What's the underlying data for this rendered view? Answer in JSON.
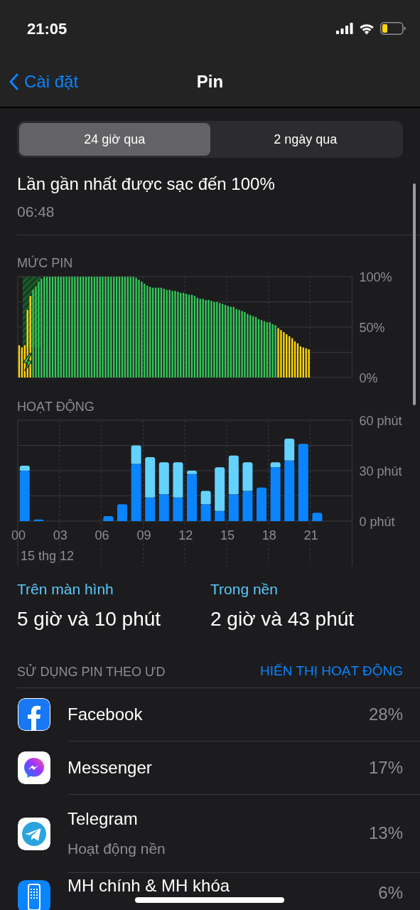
{
  "status_bar": {
    "time": "21:05"
  },
  "nav": {
    "back": "Cài đặt",
    "title": "Pin"
  },
  "segments": [
    {
      "label": "24 giờ qua",
      "selected": true
    },
    {
      "label": "2 ngày qua",
      "selected": false
    }
  ],
  "last_charged": {
    "title": "Lần gần nhất được sạc đến 100%",
    "time": "06:48"
  },
  "battery_level": {
    "heading": "MỨC PIN",
    "chart_data": {
      "type": "bar",
      "xlim": [
        0,
        24
      ],
      "ylim": [
        0,
        100
      ],
      "yticks": [
        {
          "value": 0,
          "label": "0%"
        },
        {
          "value": 50,
          "label": "50%"
        },
        {
          "value": 100,
          "label": "100%"
        }
      ],
      "x": [
        0.1,
        0.3,
        0.5,
        0.7,
        0.9,
        1.1,
        1.3,
        1.5,
        1.7,
        1.9,
        2.1,
        2.3,
        2.5,
        2.7,
        2.9,
        3.1,
        3.3,
        3.5,
        3.7,
        3.9,
        4.1,
        4.3,
        4.5,
        4.7,
        4.9,
        5.1,
        5.3,
        5.5,
        5.7,
        5.9,
        6.1,
        6.3,
        6.5,
        6.7,
        6.9,
        7.1,
        7.3,
        7.5,
        7.7,
        7.9,
        8.1,
        8.3,
        8.5,
        8.7,
        8.9,
        9.1,
        9.3,
        9.5,
        9.7,
        9.9,
        10.1,
        10.3,
        10.5,
        10.7,
        10.9,
        11.1,
        11.3,
        11.5,
        11.7,
        11.9,
        12.1,
        12.3,
        12.5,
        12.7,
        12.9,
        13.1,
        13.3,
        13.5,
        13.7,
        13.9,
        14.1,
        14.3,
        14.5,
        14.7,
        14.9,
        15.1,
        15.3,
        15.5,
        15.7,
        15.9,
        16.1,
        16.3,
        16.5,
        16.7,
        16.9,
        17.1,
        17.3,
        17.5,
        17.7,
        17.9,
        18.1,
        18.3,
        18.5,
        18.7,
        18.9,
        19.1,
        19.3,
        19.5,
        19.7,
        19.9,
        20.1,
        20.3,
        20.5,
        20.7,
        20.9
      ],
      "series": [
        {
          "color": "#34c759",
          "values": [
            null,
            null,
            null,
            null,
            null,
            87,
            90,
            95,
            98,
            100,
            100,
            100,
            100,
            100,
            100,
            100,
            100,
            100,
            100,
            100,
            100,
            100,
            100,
            100,
            100,
            100,
            100,
            100,
            100,
            100,
            100,
            100,
            100,
            100,
            100,
            100,
            100,
            100,
            100,
            100,
            100,
            100,
            99,
            97,
            95,
            93,
            91,
            90,
            89,
            89,
            89,
            89,
            88,
            87,
            87,
            86,
            86,
            85,
            84,
            84,
            83,
            82,
            82,
            81,
            79,
            78,
            78,
            77,
            77,
            76,
            75,
            75,
            74,
            73,
            72,
            71,
            70,
            70,
            68,
            67,
            66,
            65,
            63,
            62,
            61,
            60,
            58,
            57,
            56,
            55,
            55,
            53,
            52,
            null,
            null,
            null,
            null,
            null,
            null,
            null,
            null,
            null,
            null,
            null,
            null
          ]
        },
        {
          "color": "#ffd60a",
          "values": [
            32,
            30,
            32,
            67,
            81,
            null,
            null,
            null,
            null,
            null,
            null,
            null,
            null,
            null,
            null,
            null,
            null,
            null,
            null,
            null,
            null,
            null,
            null,
            null,
            null,
            null,
            null,
            null,
            null,
            null,
            null,
            null,
            null,
            null,
            null,
            null,
            null,
            null,
            null,
            null,
            null,
            null,
            null,
            null,
            null,
            null,
            null,
            null,
            null,
            null,
            null,
            null,
            null,
            null,
            null,
            null,
            null,
            null,
            null,
            null,
            null,
            null,
            null,
            null,
            null,
            null,
            null,
            null,
            null,
            null,
            null,
            null,
            null,
            null,
            null,
            null,
            null,
            null,
            null,
            null,
            null,
            null,
            null,
            null,
            null,
            null,
            null,
            null,
            null,
            null,
            null,
            null,
            null,
            49,
            47,
            45,
            43,
            41,
            39,
            36,
            34,
            31,
            30,
            29,
            28
          ]
        }
      ],
      "grid": true
    }
  },
  "activity": {
    "heading": "HOẠT ĐỘNG",
    "chart_data": {
      "type": "bar",
      "stacked": true,
      "grid": true,
      "xlim": [
        0,
        24
      ],
      "ylim": [
        0,
        60
      ],
      "xlabel": "15 thg 12",
      "x": [
        0.5,
        1.5,
        2.5,
        3.5,
        4.5,
        5.5,
        6.5,
        7.5,
        8.5,
        9.5,
        10.5,
        11.5,
        12.5,
        13.5,
        14.5,
        15.5,
        16.5,
        17.5,
        18.5,
        19.5,
        20.5,
        21.5
      ],
      "xticks": [
        {
          "value": 0,
          "label": "00"
        },
        {
          "value": 3,
          "label": "03"
        },
        {
          "value": 6,
          "label": "06"
        },
        {
          "value": 9,
          "label": "09"
        },
        {
          "value": 12,
          "label": "12"
        },
        {
          "value": 15,
          "label": "15"
        },
        {
          "value": 18,
          "label": "18"
        },
        {
          "value": 21,
          "label": "21"
        }
      ],
      "yticks": [
        {
          "value": 0,
          "label": "0 phút"
        },
        {
          "value": 30,
          "label": "30 phút"
        },
        {
          "value": 60,
          "label": "60 phút"
        }
      ],
      "series": [
        {
          "name": "Trên màn hình",
          "color": "#0a84ff",
          "values": [
            30,
            1,
            null,
            null,
            null,
            null,
            3,
            10,
            34,
            14,
            16,
            14,
            28,
            10,
            6,
            16,
            18,
            20,
            32,
            36,
            46,
            5
          ]
        },
        {
          "name": "Trong nền",
          "color": "#64d2ff",
          "values": [
            3,
            null,
            null,
            null,
            null,
            null,
            null,
            null,
            11,
            24,
            19,
            21,
            2,
            8,
            26,
            23,
            17,
            null,
            3,
            13,
            null,
            null
          ]
        }
      ]
    },
    "totals": [
      "5 giờ và 10 phút",
      "2 giờ và 43 phút"
    ]
  },
  "app_usage": {
    "heading": "SỬ DỤNG PIN THEO ƯD",
    "action": "HIỂN THỊ HOẠT ĐỘNG",
    "apps": [
      {
        "kind": "facebook",
        "name": "Facebook",
        "percent": "28%"
      },
      {
        "kind": "messenger",
        "name": "Messenger",
        "percent": "17%"
      },
      {
        "kind": "telegram",
        "name": "Telegram",
        "detail": "Hoạt động nền",
        "percent": "13%"
      },
      {
        "kind": "homescreen",
        "name": "MH chính & MH khóa",
        "percent": "6%"
      }
    ]
  }
}
